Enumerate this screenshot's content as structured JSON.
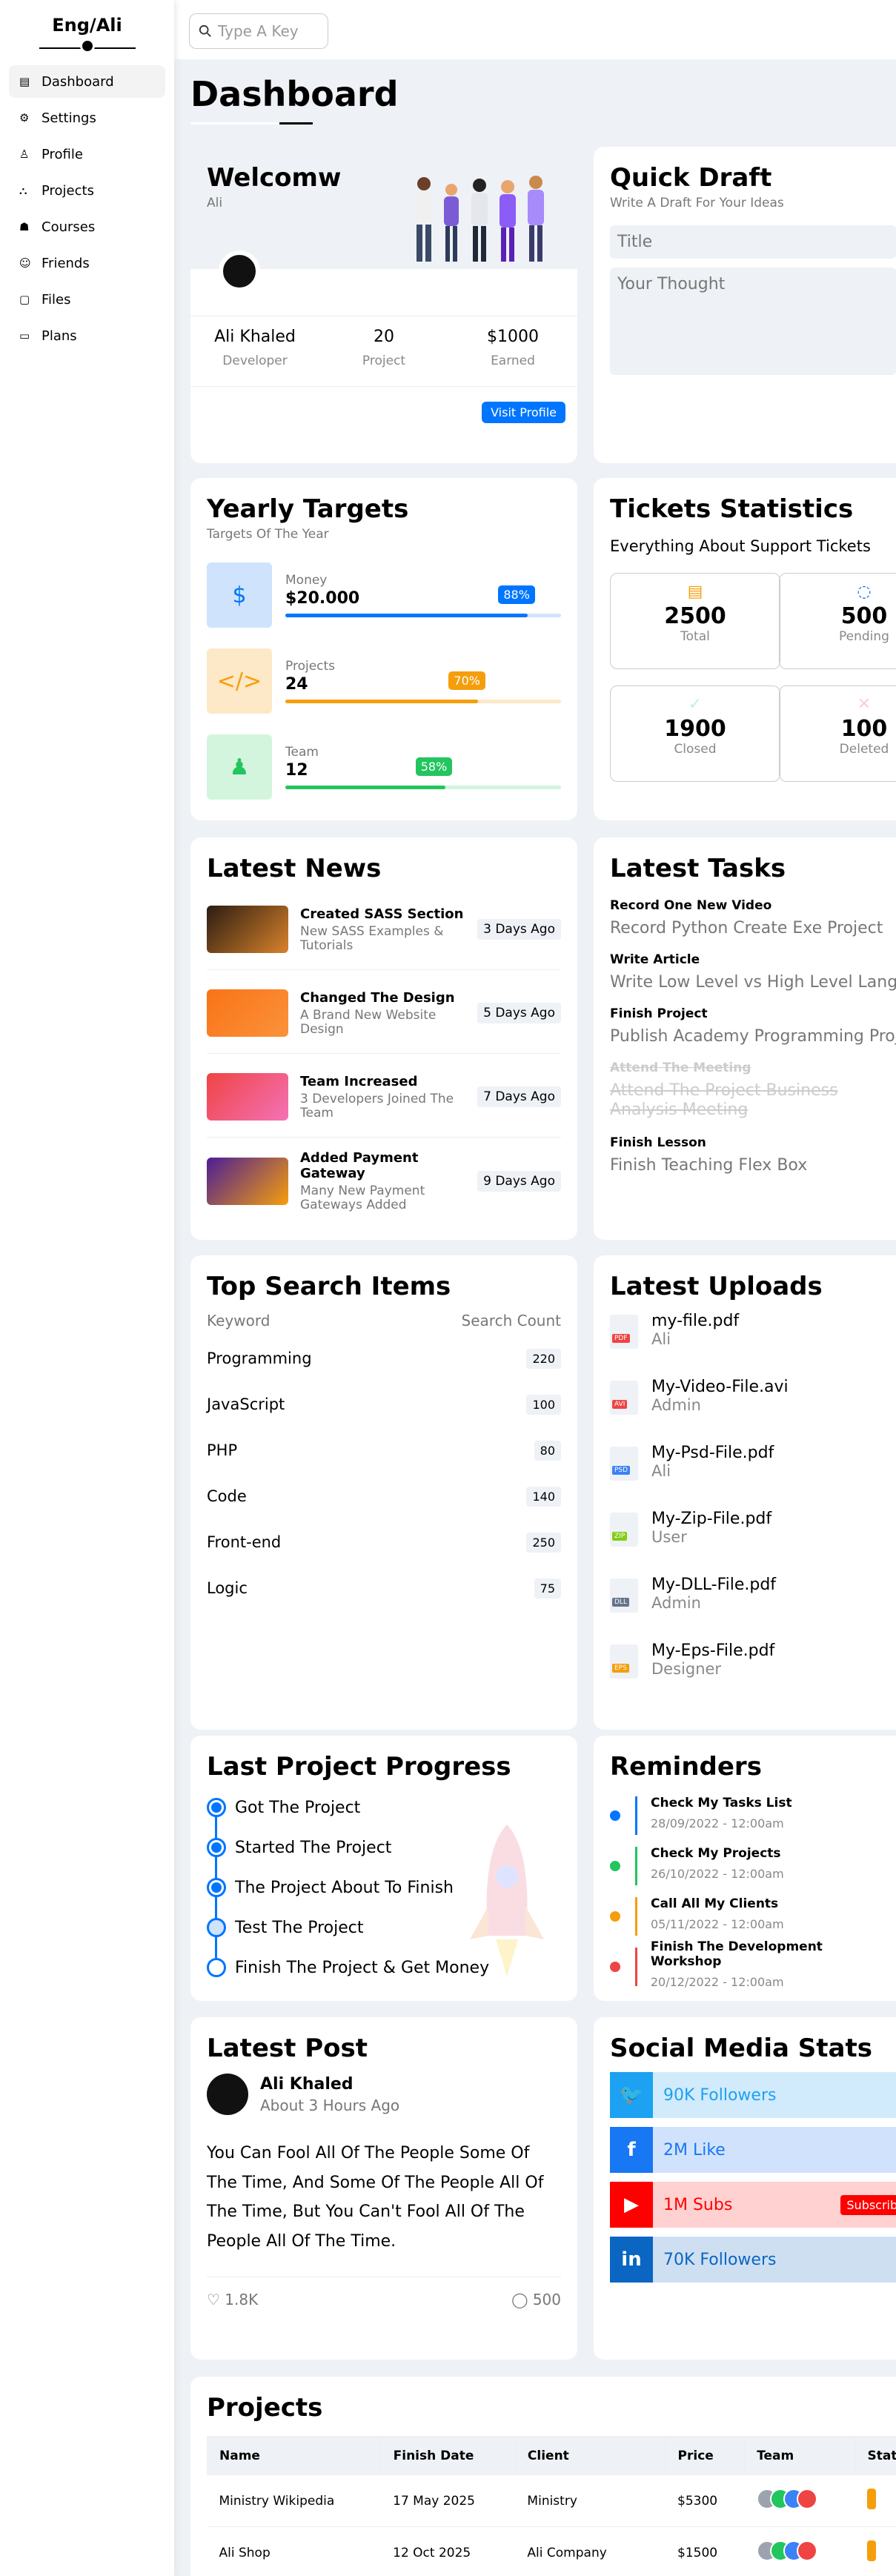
{
  "brand": "Eng/Ali",
  "nav": [
    "Dashboard",
    "Settings",
    "Profile",
    "Projects",
    "Courses",
    "Friends",
    "Files",
    "Plans"
  ],
  "search_placeholder": "Type A Key",
  "page_title": "Dashboard",
  "welcome": {
    "title": "Welcomw",
    "name_sub": "Ali",
    "full_name": "Ali Khaled",
    "role": "Developer",
    "projects": "20",
    "projects_label": "Project",
    "earned": "$1000",
    "earned_label": "Earned",
    "button": "Visit Profile"
  },
  "quick_draft": {
    "title": "Quick Draft",
    "sub": "Write A Draft For Your Ideas",
    "title_placeholder": "Title",
    "thought_placeholder": "Your Thought"
  },
  "yearly": {
    "title": "Yearly Targets",
    "sub": "Targets Of The Year",
    "items": [
      {
        "label": "Money",
        "value": "$20.000",
        "pct": "88%",
        "progress": 0.88,
        "color": "#0075ff",
        "bg": "#cfe3fd"
      },
      {
        "label": "Projects",
        "value": "24",
        "pct": "70%",
        "progress": 0.7,
        "color": "#f59e0b",
        "bg": "#fde8c7"
      },
      {
        "label": "Team",
        "value": "12",
        "pct": "58%",
        "progress": 0.58,
        "color": "#22c55e",
        "bg": "#d3f5dd"
      }
    ]
  },
  "tickets": {
    "title": "Tickets Statistics",
    "sub": "Everything About Support Tickets",
    "items": [
      {
        "value": "2500",
        "label": "Total"
      },
      {
        "value": "500",
        "label": "Pending"
      },
      {
        "value": "1900",
        "label": "Closed"
      },
      {
        "value": "100",
        "label": "Deleted"
      }
    ]
  },
  "news": {
    "title": "Latest News",
    "items": [
      {
        "title": "Created SASS Section",
        "desc": "New SASS Examples & Tutorials",
        "ago": "3 Days Ago"
      },
      {
        "title": "Changed The Design",
        "desc": "A Brand New Website Design",
        "ago": "5 Days Ago"
      },
      {
        "title": "Team Increased",
        "desc": "3 Developers Joined The Team",
        "ago": "7 Days Ago"
      },
      {
        "title": "Added Payment Gateway",
        "desc": "Many New Payment Gateways Added",
        "ago": "9 Days Ago"
      }
    ]
  },
  "tasks": {
    "title": "Latest Tasks",
    "items": [
      {
        "title": "Record One New Video",
        "desc": "Record Python Create Exe Project"
      },
      {
        "title": "Write Article",
        "desc": "Write Low Level vs High Level Languages"
      },
      {
        "title": "Finish Project",
        "desc": "Publish Academy Programming Project"
      },
      {
        "title": "Attend The Meeting",
        "desc": "Attend The Project Business Analysis Meeting"
      },
      {
        "title": "Finish Lesson",
        "desc": "Finish Teaching Flex Box"
      }
    ]
  },
  "top_search": {
    "title": "Top Search Items",
    "col1": "Keyword",
    "col2": "Search Count",
    "rows": [
      {
        "k": "Programming",
        "v": "220"
      },
      {
        "k": "JavaScript",
        "v": "100"
      },
      {
        "k": "PHP",
        "v": "80"
      },
      {
        "k": "Code",
        "v": "140"
      },
      {
        "k": "Front-end",
        "v": "250"
      },
      {
        "k": "Logic",
        "v": "75"
      }
    ]
  },
  "uploads": {
    "title": "Latest Uploads",
    "items": [
      {
        "file": "my-file.pdf",
        "user": "Ali",
        "ext": "PDF"
      },
      {
        "file": "My-Video-File.avi",
        "user": "Admin",
        "ext": "AVI"
      },
      {
        "file": "My-Psd-File.pdf",
        "user": "Ali",
        "ext": "PSD"
      },
      {
        "file": "My-Zip-File.pdf",
        "user": "User",
        "ext": "ZIP"
      },
      {
        "file": "My-DLL-File.pdf",
        "user": "Admin",
        "ext": "DLL"
      },
      {
        "file": "My-Eps-File.pdf",
        "user": "Designer",
        "ext": "EPS"
      }
    ]
  },
  "progress": {
    "title": "Last Project Progress",
    "items": [
      "Got The Project",
      "Started The Project",
      "The Project About To Finish",
      "Test The Project",
      "Finish The Project & Get Money"
    ]
  },
  "reminders": {
    "title": "Reminders",
    "items": [
      {
        "title": "Check My Tasks List",
        "date": "28/09/2022 - 12:00am",
        "color": "#0075ff"
      },
      {
        "title": "Check My Projects",
        "date": "26/10/2022 - 12:00am",
        "color": "#22c55e"
      },
      {
        "title": "Call All My Clients",
        "date": "05/11/2022 - 12:00am",
        "color": "#f59e0b"
      },
      {
        "title": "Finish The Development Workshop",
        "date": "20/12/2022 - 12:00am",
        "color": "#ef4444"
      }
    ]
  },
  "post": {
    "title": "Latest Post",
    "author": "Ali Khaled",
    "time": "About 3 Hours Ago",
    "body": "You Can Fool All Of The People Some Of The Time, And Some Of The People All Of The Time, But You Can't Fool All Of The People All Of The Time.",
    "likes": "1.8K",
    "comments": "500"
  },
  "social": {
    "title": "Social Media Stats",
    "items": [
      {
        "text": "90K Followers",
        "color": "#1da1f2",
        "bg": "#d1ebfc"
      },
      {
        "text": "2M Like",
        "color": "#1877f2",
        "bg": "#d1e3fc"
      },
      {
        "text": "1M Subs",
        "color": "#ff0000",
        "bg": "#ffd1d1",
        "btn": "Subscribe"
      },
      {
        "text": "70K Followers",
        "color": "#0a66c2",
        "bg": "#cfdff2"
      }
    ]
  },
  "projects": {
    "title": "Projects",
    "cols": [
      "Name",
      "Finish Date",
      "Client",
      "Price",
      "Team",
      "Status"
    ],
    "rows": [
      {
        "name": "Ministry Wikipedia",
        "date": "17 May 2025",
        "client": "Ministry",
        "price": "$5300"
      },
      {
        "name": "Ali Shop",
        "date": "12 Oct 2025",
        "client": "Ali Company",
        "price": "$1500"
      }
    ]
  }
}
